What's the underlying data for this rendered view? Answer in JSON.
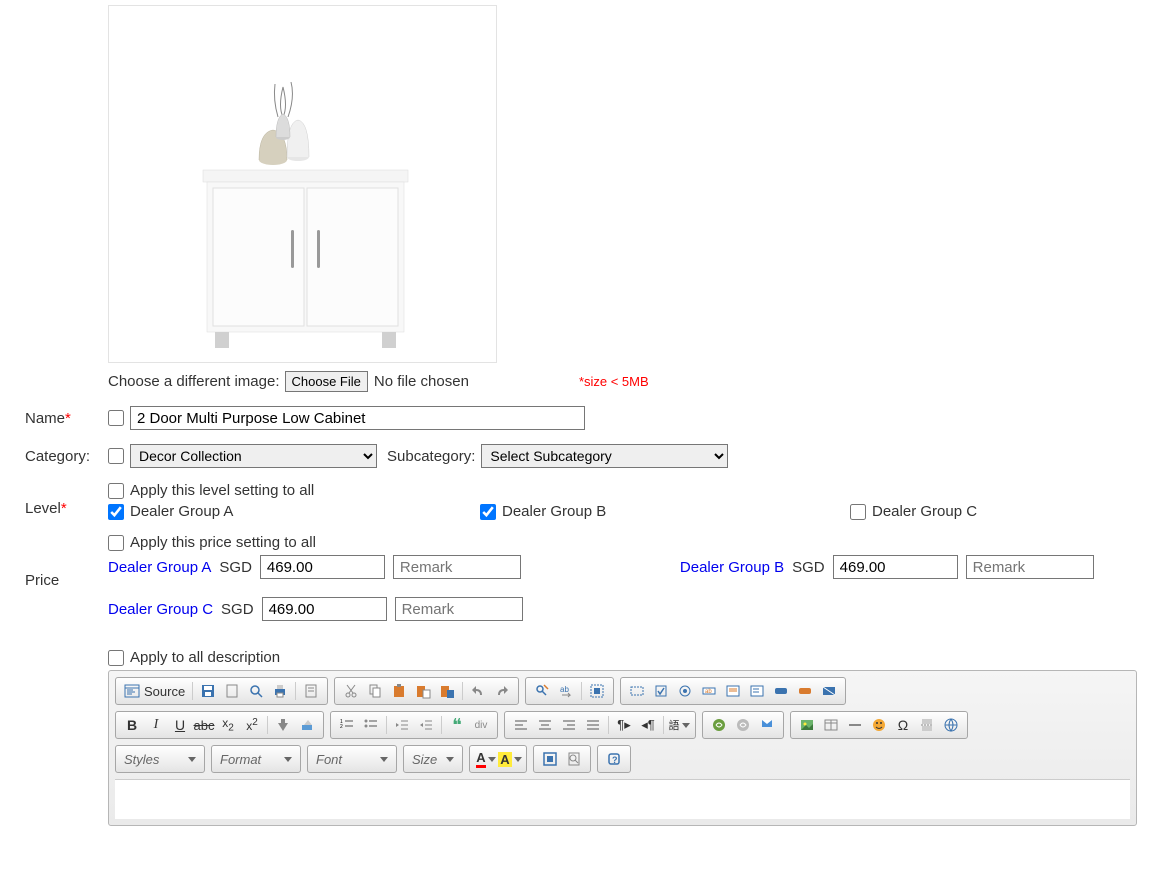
{
  "image": {
    "choose_label": "Choose a different image:",
    "button": "Choose File",
    "status": "No file chosen",
    "size_note": "*size < 5MB"
  },
  "name": {
    "label": "Name",
    "value": "2 Door Multi Purpose Low Cabinet"
  },
  "category": {
    "label": "Category:",
    "value": "Decor Collection",
    "sub_label": "Subcategory:",
    "sub_value": "Select Subcategory"
  },
  "level": {
    "label": "Level",
    "apply_all": "Apply this level setting to all",
    "groups": [
      {
        "label": "Dealer Group A",
        "checked": true
      },
      {
        "label": "Dealer Group B",
        "checked": true
      },
      {
        "label": "Dealer Group C",
        "checked": false
      }
    ]
  },
  "price": {
    "label": "Price",
    "apply_all": "Apply this price setting to all",
    "currency": "SGD",
    "remark_placeholder": "Remark",
    "groups": [
      {
        "label": "Dealer Group A",
        "value": "469.00"
      },
      {
        "label": "Dealer Group B",
        "value": "469.00"
      },
      {
        "label": "Dealer Group C",
        "value": "469.00"
      }
    ]
  },
  "description": {
    "apply_all": "Apply to all description"
  },
  "editor": {
    "source": "Source",
    "styles": "Styles",
    "format": "Format",
    "font": "Font",
    "size": "Size"
  }
}
